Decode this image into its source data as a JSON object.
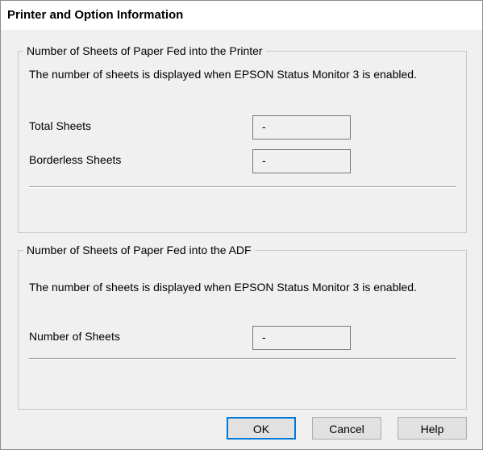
{
  "window": {
    "title": "Printer and Option Information"
  },
  "printer_section": {
    "legend": "Number of Sheets of Paper Fed into the Printer",
    "description": "The number of sheets is displayed when EPSON Status Monitor 3 is enabled.",
    "total_sheets": {
      "label": "Total Sheets",
      "value": "-"
    },
    "borderless_sheets": {
      "label": "Borderless Sheets",
      "value": "-"
    }
  },
  "adf_section": {
    "legend": "Number of Sheets of Paper Fed into the ADF",
    "description": "The number of sheets is displayed when EPSON Status Monitor 3 is enabled.",
    "number_of_sheets": {
      "label": "Number of Sheets",
      "value": "-"
    }
  },
  "buttons": {
    "ok": "OK",
    "cancel": "Cancel",
    "help": "Help"
  }
}
